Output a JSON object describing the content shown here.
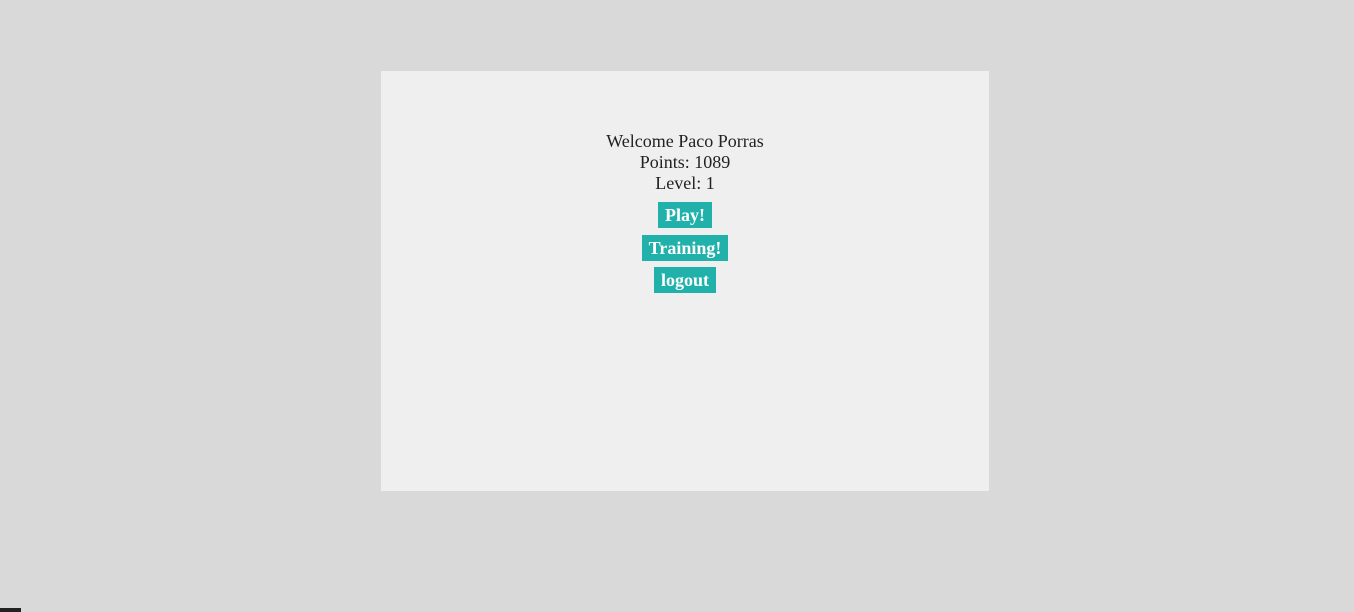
{
  "user": {
    "welcome_text": "Welcome Paco Porras",
    "points_text": "Points: 1089",
    "level_text": "Level: 1"
  },
  "actions": {
    "play_label": "Play!",
    "training_label": "Training!",
    "logout_label": "logout"
  },
  "colors": {
    "page_background": "#d9d9d9",
    "panel_background": "#efefef",
    "button_background": "#20b2aa",
    "button_text": "#ffffff"
  }
}
